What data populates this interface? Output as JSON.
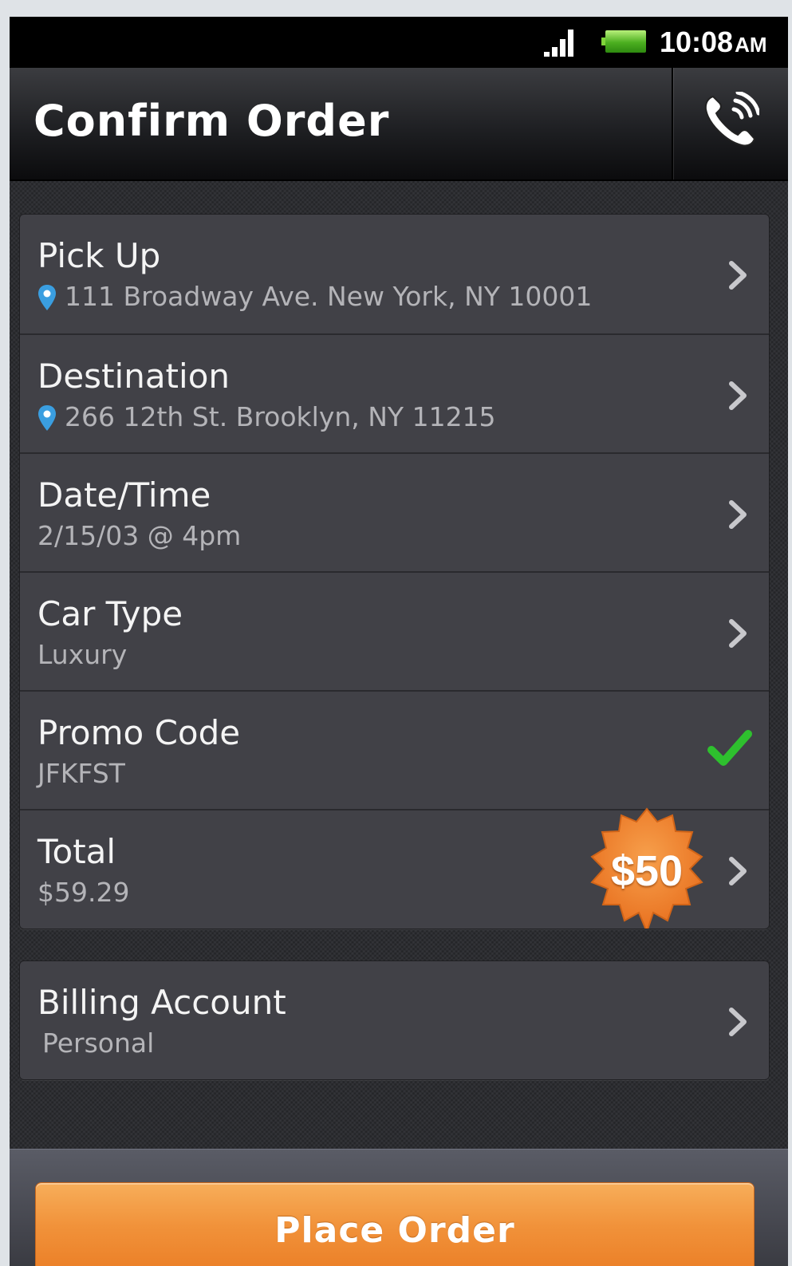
{
  "status_bar": {
    "time": "10:08",
    "ampm": "AM",
    "icons": [
      "signal-icon",
      "battery-icon"
    ],
    "battery_color": "#4caf20"
  },
  "header": {
    "title": "Confirm Order",
    "action_icon": "phone-call-icon"
  },
  "order": {
    "rows": [
      {
        "label": "Pick Up",
        "value": "111 Broadway Ave. New York, NY 10001",
        "icon": "pin-icon",
        "trailing": "chevron-right-icon"
      },
      {
        "label": "Destination",
        "value": "266 12th St. Brooklyn, NY 11215",
        "icon": "pin-icon",
        "trailing": "chevron-right-icon"
      },
      {
        "label": "Date/Time",
        "value": "2/15/03 @ 4pm",
        "trailing": "chevron-right-icon"
      },
      {
        "label": "Car Type",
        "value": "Luxury",
        "trailing": "chevron-right-icon"
      },
      {
        "label": "Promo Code",
        "value": "JFKFST",
        "trailing": "check-icon"
      },
      {
        "label": "Total",
        "value": "$59.29",
        "badge": "$50",
        "trailing": "chevron-right-icon"
      }
    ]
  },
  "billing": {
    "label": "Billing Account",
    "value": "Personal",
    "trailing": "chevron-right-icon"
  },
  "footer": {
    "place_order_label": "Place Order"
  },
  "colors": {
    "accent_orange": "#f1923a",
    "check_green": "#2ec02e",
    "pin_blue": "#3a9ee0",
    "card_bg": "#414147"
  }
}
